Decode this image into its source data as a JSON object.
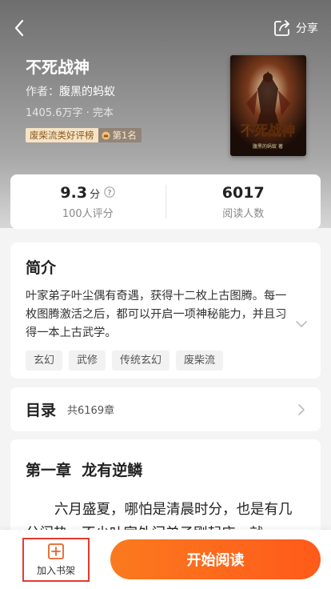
{
  "header": {
    "back_icon": "chevron-left-icon",
    "share_icon": "share-icon",
    "share_label": "分享"
  },
  "book": {
    "title": "不死战神",
    "author_prefix": "作者：",
    "author": "腹黑的蚂蚁",
    "meta": "1405.6万字 · 完本",
    "rank_tag": "废柴流类好评榜",
    "rank_position": "第1名",
    "cover": {
      "title_art": "不死战神",
      "caption": "腹黑的蚂蚁 著"
    }
  },
  "stats": {
    "score": "9.3",
    "score_unit": "分",
    "score_label": "100人评分",
    "readers": "6017",
    "readers_label": "阅读人数"
  },
  "intro": {
    "heading": "简介",
    "text": "叶家弟子叶尘偶有奇遇，获得十二枚上古图腾。每一枚图腾激活之后，都可以开启一项神秘能力，并且习得一本上古武学。",
    "tags": [
      "玄幻",
      "武修",
      "传统玄幻",
      "废柴流"
    ]
  },
  "toc": {
    "heading": "目录",
    "count": "共6169章"
  },
  "chapter": {
    "title": "第一章  龙有逆鳞",
    "body": "六月盛夏，哪怕是清晨时分，也是有几分闷热，不少叶家外门弟子刚起床，就"
  },
  "actions": {
    "add_shelf": "加入书架",
    "start_reading": "开始阅读"
  },
  "colors": {
    "accent": "#ff5a1a",
    "highlight_border": "#e63a2c"
  }
}
